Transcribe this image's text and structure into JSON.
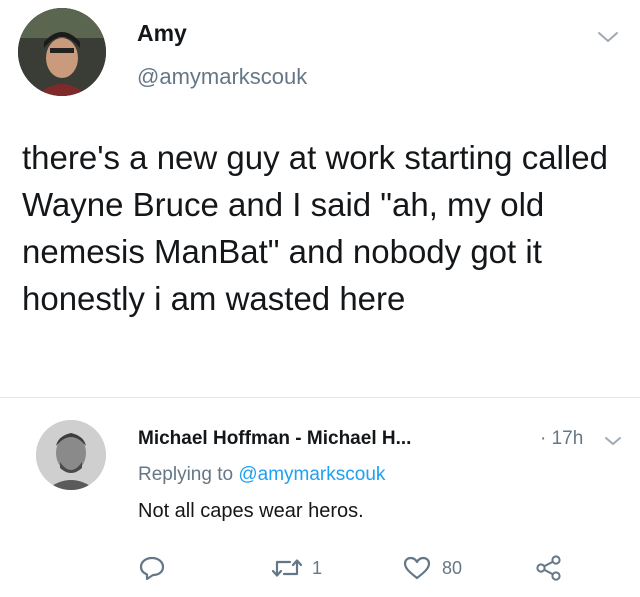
{
  "tweet": {
    "author_name": "Amy",
    "author_handle": "@amymarkscouk",
    "text": "there's a new guy at work starting called Wayne Bruce and I said \"ah, my old nemesis ManBat\" and nobody got it honestly i am wasted here",
    "icons": {
      "avatar": "user-avatar-photo",
      "menu": "chevron-down-icon"
    }
  },
  "reply": {
    "author_name": "Michael Hoffman - Michael H...",
    "separator": "·",
    "time": "17h",
    "replying_prefix": "Replying to",
    "replying_handle": "@amymarkscouk",
    "text": "Not all capes wear heros.",
    "actions": {
      "retweet_count": "1",
      "like_count": "80"
    },
    "icons": {
      "reply": "reply-bubble-icon",
      "retweet": "retweet-icon",
      "like": "heart-icon",
      "share": "share-icon"
    }
  },
  "colors": {
    "text": "#14171a",
    "secondary": "#657786",
    "link": "#1da1f2",
    "divider": "#e1e8ed"
  }
}
